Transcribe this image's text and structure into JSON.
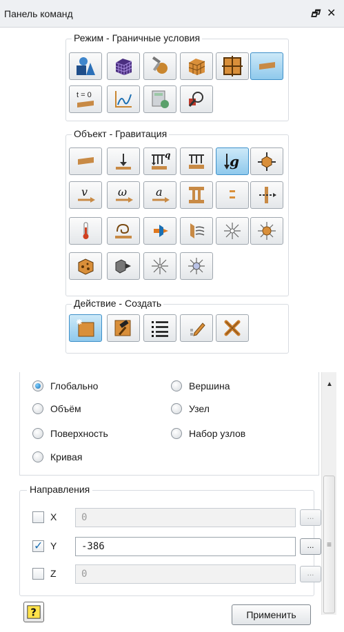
{
  "panel": {
    "title": "Панель команд",
    "restore_glyph": "🗗",
    "close_glyph": "✕"
  },
  "mode": {
    "title": "Режим - Граничные условия",
    "buttons": [
      {
        "icon": "geometry-shapes-icon",
        "active": false
      },
      {
        "icon": "mesh-cube-icon",
        "active": false
      },
      {
        "icon": "materials-wrench-icon",
        "active": false
      },
      {
        "icon": "properties-cube-icon",
        "active": false
      },
      {
        "icon": "mesh-grid-icon",
        "active": false
      },
      {
        "icon": "boundary-conditions-icon",
        "active": true
      },
      {
        "icon": "initial-conditions-icon",
        "label": "t = 0",
        "active": false
      },
      {
        "icon": "load-curve-icon",
        "active": false
      },
      {
        "icon": "calculator-settings-icon",
        "active": false
      },
      {
        "icon": "results-magnifier-icon",
        "active": false
      }
    ]
  },
  "object": {
    "title": "Объект - Гравитация",
    "buttons": [
      {
        "icon": "beam-load-icon",
        "active": false
      },
      {
        "icon": "point-force-icon",
        "active": false
      },
      {
        "icon": "distributed-load-q-icon",
        "label": "q",
        "active": false
      },
      {
        "icon": "pressure-load-icon",
        "active": false
      },
      {
        "icon": "gravity-g-icon",
        "label": "g",
        "active": true
      },
      {
        "icon": "body-force-cube-icon",
        "active": false
      },
      {
        "icon": "velocity-v-icon",
        "label": "v",
        "active": false
      },
      {
        "icon": "angular-velocity-omega-icon",
        "label": "ω",
        "active": false
      },
      {
        "icon": "acceleration-a-icon",
        "label": "a",
        "active": false
      },
      {
        "icon": "column-support-icon",
        "active": false
      },
      {
        "icon": "symmetry-icon",
        "active": false
      },
      {
        "icon": "constraint-arrow-icon",
        "active": false
      },
      {
        "icon": "thermometer-icon",
        "active": false
      },
      {
        "icon": "heat-flux-icon",
        "active": false
      },
      {
        "icon": "convection-icon",
        "active": false
      },
      {
        "icon": "radiation-surface-icon",
        "active": false
      },
      {
        "icon": "light-source-icon",
        "active": false
      },
      {
        "icon": "sun-source-icon",
        "active": false
      },
      {
        "icon": "heat-cube-icon",
        "active": false
      },
      {
        "icon": "flow-cube-icon",
        "active": false
      },
      {
        "icon": "point-light-icon",
        "active": false
      },
      {
        "icon": "sphere-light-icon",
        "active": false
      }
    ]
  },
  "action": {
    "title": "Действие - Создать",
    "buttons": [
      {
        "icon": "create-new-icon",
        "active": true
      },
      {
        "icon": "edit-hammer-icon",
        "active": false
      },
      {
        "icon": "list-icon",
        "active": false
      },
      {
        "icon": "rename-pencil-icon",
        "active": false
      },
      {
        "icon": "delete-x-icon",
        "active": false
      }
    ]
  },
  "apply_to": {
    "options_left": [
      "Глобально",
      "Объём",
      "Поверхность",
      "Кривая"
    ],
    "options_right": [
      "Вершина",
      "Узел",
      "Набор узлов"
    ],
    "selected": "Глобально"
  },
  "directions": {
    "title": "Направления",
    "rows": [
      {
        "axis": "X",
        "checked": false,
        "value": "0"
      },
      {
        "axis": "Y",
        "checked": true,
        "value": "-386"
      },
      {
        "axis": "Z",
        "checked": false,
        "value": "0"
      }
    ],
    "browse_label": "..."
  },
  "help_label": "?",
  "apply_label": "Применить",
  "colors": {
    "accent": "#3b8ec8",
    "wood": "#d98f3a",
    "active_bg": "#8fc9ec"
  }
}
